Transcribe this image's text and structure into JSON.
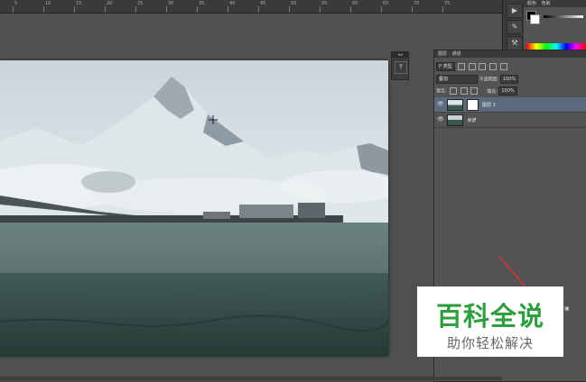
{
  "ruler": {
    "labels": [
      "5",
      "10",
      "15",
      "20",
      "25",
      "30",
      "35",
      "40",
      "45",
      "50",
      "55",
      "60",
      "65",
      "70",
      "75"
    ]
  },
  "color_panel": {
    "tabs": [
      "颜色",
      "色板"
    ],
    "foreground": "#000000",
    "background": "#ffffff"
  },
  "mid_toolbar": {
    "buttons": [
      "play-icon",
      "adjust-icon",
      "tool-preset-icon"
    ]
  },
  "tool_strip": {
    "collapse_label": "◂◂",
    "button_glyph": "⤒"
  },
  "layers_panel": {
    "tabs": [
      "图层",
      "通道"
    ],
    "filter_label": "P 类型",
    "blend_mode": "叠加",
    "opacity_label": "不透明度:",
    "opacity_value": "100%",
    "lock_label": "锁定:",
    "fill_label": "填充:",
    "fill_value": "100%",
    "layers": [
      {
        "name": "图层 1",
        "selected": true,
        "has_mask": true
      },
      {
        "name": "背景",
        "selected": false,
        "has_mask": false
      }
    ]
  },
  "watermark": {
    "title": "百科全说",
    "subtitle": "助你轻松解决"
  },
  "colors": {
    "panel_bg": "#535353",
    "selected_layer": "#5b6a7d",
    "watermark_green": "#2f9e3f",
    "arrow_red": "#e0322b"
  }
}
